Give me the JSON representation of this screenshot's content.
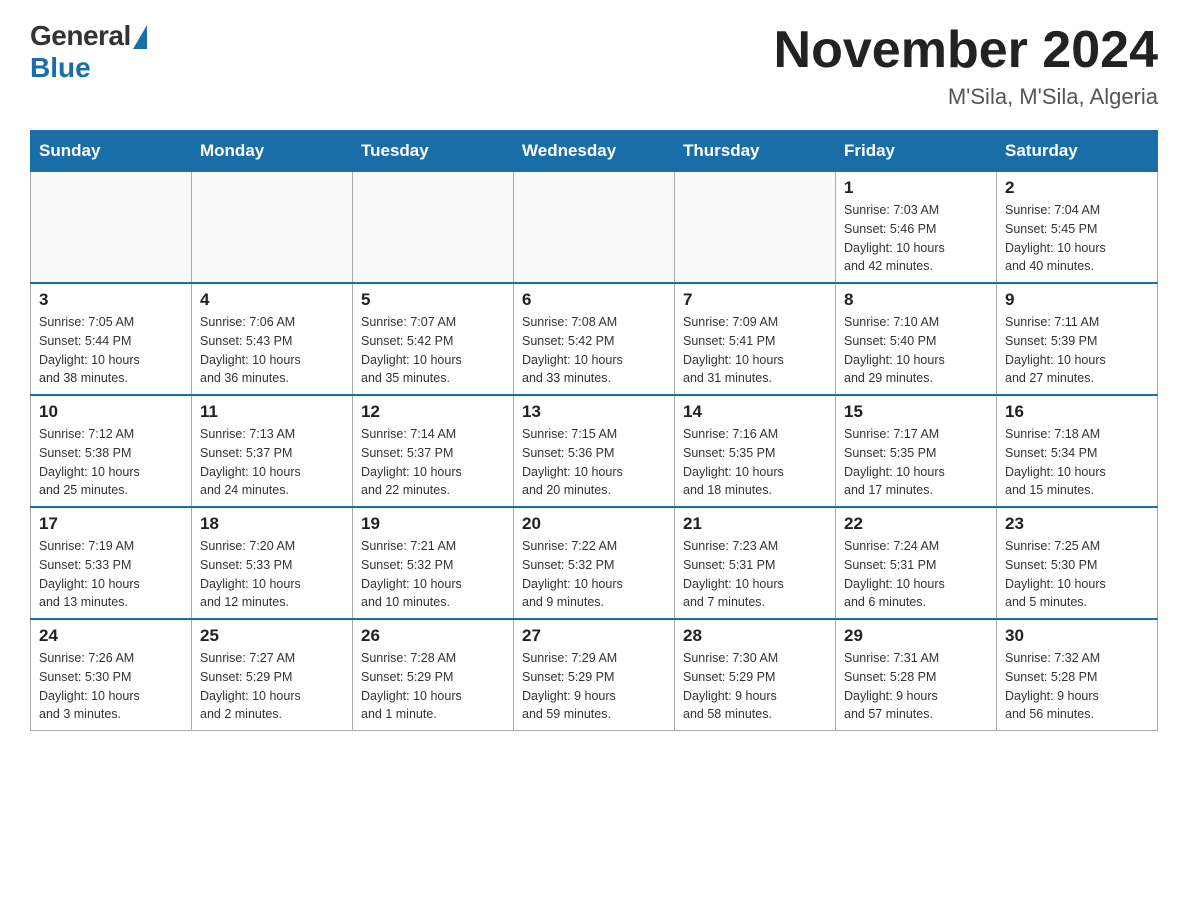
{
  "header": {
    "logo_general": "General",
    "logo_blue": "Blue",
    "month_title": "November 2024",
    "location": "M'Sila, M'Sila, Algeria"
  },
  "weekdays": [
    "Sunday",
    "Monday",
    "Tuesday",
    "Wednesday",
    "Thursday",
    "Friday",
    "Saturday"
  ],
  "weeks": [
    [
      {
        "day": "",
        "info": ""
      },
      {
        "day": "",
        "info": ""
      },
      {
        "day": "",
        "info": ""
      },
      {
        "day": "",
        "info": ""
      },
      {
        "day": "",
        "info": ""
      },
      {
        "day": "1",
        "info": "Sunrise: 7:03 AM\nSunset: 5:46 PM\nDaylight: 10 hours\nand 42 minutes."
      },
      {
        "day": "2",
        "info": "Sunrise: 7:04 AM\nSunset: 5:45 PM\nDaylight: 10 hours\nand 40 minutes."
      }
    ],
    [
      {
        "day": "3",
        "info": "Sunrise: 7:05 AM\nSunset: 5:44 PM\nDaylight: 10 hours\nand 38 minutes."
      },
      {
        "day": "4",
        "info": "Sunrise: 7:06 AM\nSunset: 5:43 PM\nDaylight: 10 hours\nand 36 minutes."
      },
      {
        "day": "5",
        "info": "Sunrise: 7:07 AM\nSunset: 5:42 PM\nDaylight: 10 hours\nand 35 minutes."
      },
      {
        "day": "6",
        "info": "Sunrise: 7:08 AM\nSunset: 5:42 PM\nDaylight: 10 hours\nand 33 minutes."
      },
      {
        "day": "7",
        "info": "Sunrise: 7:09 AM\nSunset: 5:41 PM\nDaylight: 10 hours\nand 31 minutes."
      },
      {
        "day": "8",
        "info": "Sunrise: 7:10 AM\nSunset: 5:40 PM\nDaylight: 10 hours\nand 29 minutes."
      },
      {
        "day": "9",
        "info": "Sunrise: 7:11 AM\nSunset: 5:39 PM\nDaylight: 10 hours\nand 27 minutes."
      }
    ],
    [
      {
        "day": "10",
        "info": "Sunrise: 7:12 AM\nSunset: 5:38 PM\nDaylight: 10 hours\nand 25 minutes."
      },
      {
        "day": "11",
        "info": "Sunrise: 7:13 AM\nSunset: 5:37 PM\nDaylight: 10 hours\nand 24 minutes."
      },
      {
        "day": "12",
        "info": "Sunrise: 7:14 AM\nSunset: 5:37 PM\nDaylight: 10 hours\nand 22 minutes."
      },
      {
        "day": "13",
        "info": "Sunrise: 7:15 AM\nSunset: 5:36 PM\nDaylight: 10 hours\nand 20 minutes."
      },
      {
        "day": "14",
        "info": "Sunrise: 7:16 AM\nSunset: 5:35 PM\nDaylight: 10 hours\nand 18 minutes."
      },
      {
        "day": "15",
        "info": "Sunrise: 7:17 AM\nSunset: 5:35 PM\nDaylight: 10 hours\nand 17 minutes."
      },
      {
        "day": "16",
        "info": "Sunrise: 7:18 AM\nSunset: 5:34 PM\nDaylight: 10 hours\nand 15 minutes."
      }
    ],
    [
      {
        "day": "17",
        "info": "Sunrise: 7:19 AM\nSunset: 5:33 PM\nDaylight: 10 hours\nand 13 minutes."
      },
      {
        "day": "18",
        "info": "Sunrise: 7:20 AM\nSunset: 5:33 PM\nDaylight: 10 hours\nand 12 minutes."
      },
      {
        "day": "19",
        "info": "Sunrise: 7:21 AM\nSunset: 5:32 PM\nDaylight: 10 hours\nand 10 minutes."
      },
      {
        "day": "20",
        "info": "Sunrise: 7:22 AM\nSunset: 5:32 PM\nDaylight: 10 hours\nand 9 minutes."
      },
      {
        "day": "21",
        "info": "Sunrise: 7:23 AM\nSunset: 5:31 PM\nDaylight: 10 hours\nand 7 minutes."
      },
      {
        "day": "22",
        "info": "Sunrise: 7:24 AM\nSunset: 5:31 PM\nDaylight: 10 hours\nand 6 minutes."
      },
      {
        "day": "23",
        "info": "Sunrise: 7:25 AM\nSunset: 5:30 PM\nDaylight: 10 hours\nand 5 minutes."
      }
    ],
    [
      {
        "day": "24",
        "info": "Sunrise: 7:26 AM\nSunset: 5:30 PM\nDaylight: 10 hours\nand 3 minutes."
      },
      {
        "day": "25",
        "info": "Sunrise: 7:27 AM\nSunset: 5:29 PM\nDaylight: 10 hours\nand 2 minutes."
      },
      {
        "day": "26",
        "info": "Sunrise: 7:28 AM\nSunset: 5:29 PM\nDaylight: 10 hours\nand 1 minute."
      },
      {
        "day": "27",
        "info": "Sunrise: 7:29 AM\nSunset: 5:29 PM\nDaylight: 9 hours\nand 59 minutes."
      },
      {
        "day": "28",
        "info": "Sunrise: 7:30 AM\nSunset: 5:29 PM\nDaylight: 9 hours\nand 58 minutes."
      },
      {
        "day": "29",
        "info": "Sunrise: 7:31 AM\nSunset: 5:28 PM\nDaylight: 9 hours\nand 57 minutes."
      },
      {
        "day": "30",
        "info": "Sunrise: 7:32 AM\nSunset: 5:28 PM\nDaylight: 9 hours\nand 56 minutes."
      }
    ]
  ]
}
